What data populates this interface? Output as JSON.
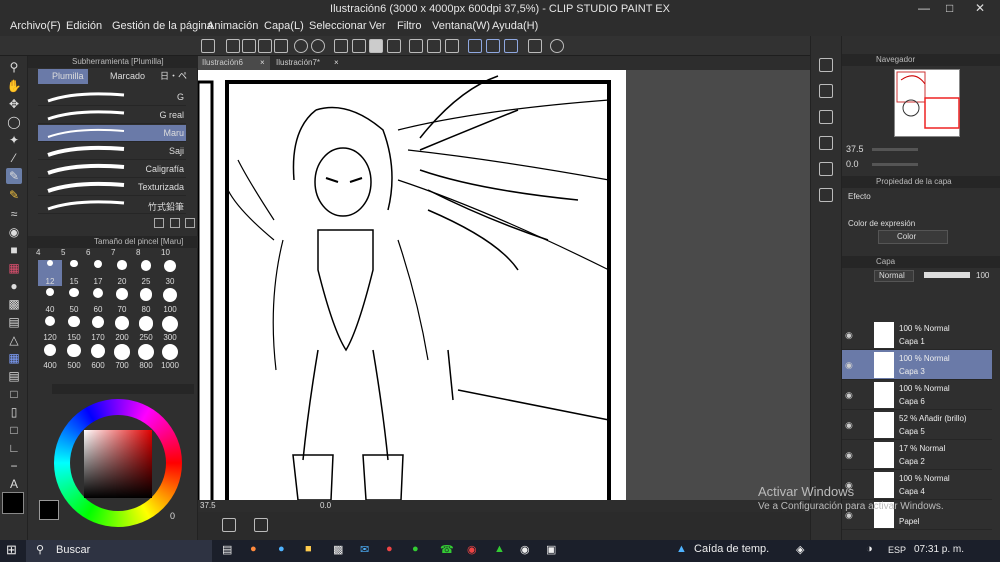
{
  "window": {
    "title": "Ilustración6 (3000 x 4000px 600dpi 37,5%) - CLIP STUDIO PAINT EX"
  },
  "menu": [
    "Archivo(F)",
    "Edición",
    "Gestión de la página",
    "Animación",
    "Capa(L)",
    "Seleccionar",
    "Ver",
    "Filtro",
    "Ventana(W)",
    "Ayuda(H)"
  ],
  "subtool": {
    "header": "Subherramienta [Plumilla]",
    "tabs": [
      "Plumilla",
      "Marcado"
    ],
    "tab3": "日・ペ",
    "brushes": [
      "G",
      "G real",
      "Maru",
      "Saji",
      "Caligrafía",
      "Texturizada",
      "竹式鉛筆"
    ],
    "selected_brush": "Maru"
  },
  "brush_size": {
    "header": "Tamaño del pincel [Maru]",
    "top_row": [
      "4",
      "5",
      "6",
      "7",
      "8",
      "10"
    ],
    "sizes": [
      "12",
      "15",
      "17",
      "20",
      "25",
      "30",
      "40",
      "50",
      "60",
      "70",
      "80",
      "100",
      "120",
      "150",
      "170",
      "200",
      "250",
      "300",
      "400",
      "500",
      "600",
      "700",
      "800",
      "1000"
    ],
    "selected": "12"
  },
  "color": {
    "foreground": "#000000",
    "background": "#ffffff",
    "corner_value": "0",
    "values": [
      "0",
      "0",
      "0"
    ]
  },
  "canvas": {
    "tabs": [
      "Ilustración6",
      "Ilustración7*"
    ],
    "zoom": "37.5",
    "rotation": "0.0"
  },
  "navigator": {
    "header": "Navegador",
    "zoom": "37.5",
    "rotation": "0.0"
  },
  "layer_property": {
    "header": "Propiedad de la capa",
    "effect_label": "Efecto",
    "expression_label": "Color de expresión",
    "expression_value": "Color"
  },
  "layers_panel": {
    "tab": "Capa",
    "blend_mode": "Normal",
    "opacity": "100",
    "layers": [
      {
        "line1": "100 % Normal",
        "line2": "Capa 1",
        "selected": false
      },
      {
        "line1": "100 % Normal",
        "line2": "Capa 3",
        "selected": true
      },
      {
        "line1": "100 % Normal",
        "line2": "Capa 6",
        "selected": false
      },
      {
        "line1": "52 % Añadir (brillo)",
        "line2": "Capa 5",
        "selected": false
      },
      {
        "line1": "17 % Normal",
        "line2": "Capa 2",
        "selected": false
      },
      {
        "line1": "100 % Normal",
        "line2": "Capa 4",
        "selected": false
      },
      {
        "line1": "",
        "line2": "Papel",
        "selected": false
      }
    ]
  },
  "watermark": {
    "line1": "Activar Windows",
    "line2": "Ve a Configuración para activar Windows."
  },
  "taskbar": {
    "search": "Buscar",
    "weather": "Caída de temp.",
    "language": "ESP",
    "time": "07:31 p. m."
  },
  "colors": {
    "accent": "#6a7aa8",
    "panel": "#2f2f2f",
    "titlebar": "#2d2d2d"
  }
}
